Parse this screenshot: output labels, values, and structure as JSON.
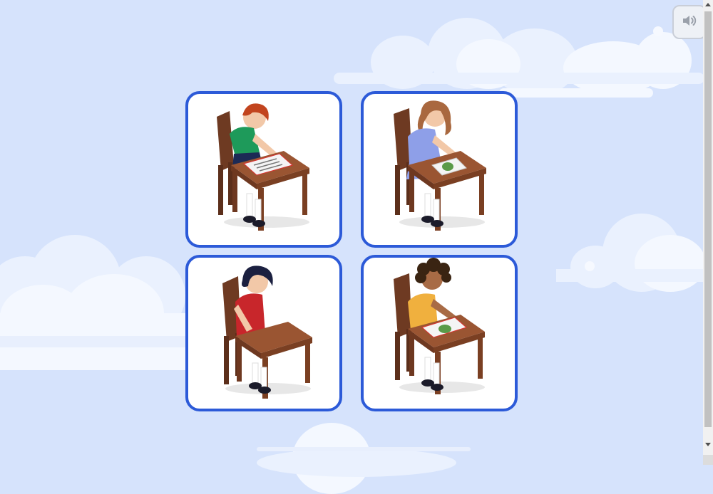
{
  "toolbar": {
    "sound_icon": "speaker-icon"
  },
  "cards": [
    {
      "id": "girl-green-shirt-writing",
      "shirt_color": "#1e9a5a",
      "hair_color": "#c2441e",
      "activity": "writing"
    },
    {
      "id": "girl-blue-dress-drawing",
      "shirt_color": "#8e9fe8",
      "hair_color": "#a9683f",
      "activity": "drawing"
    },
    {
      "id": "girl-red-dress-sitting",
      "shirt_color": "#c8262b",
      "hair_color": "#1b2040",
      "activity": "sitting"
    },
    {
      "id": "girl-yellow-shirt-drawing",
      "shirt_color": "#f0b03e",
      "hair_color": "#3a2412",
      "activity": "drawing"
    }
  ],
  "colors": {
    "card_border": "#2c5ad8",
    "background": "#d6e3fc",
    "desk": "#8b4a2b"
  }
}
